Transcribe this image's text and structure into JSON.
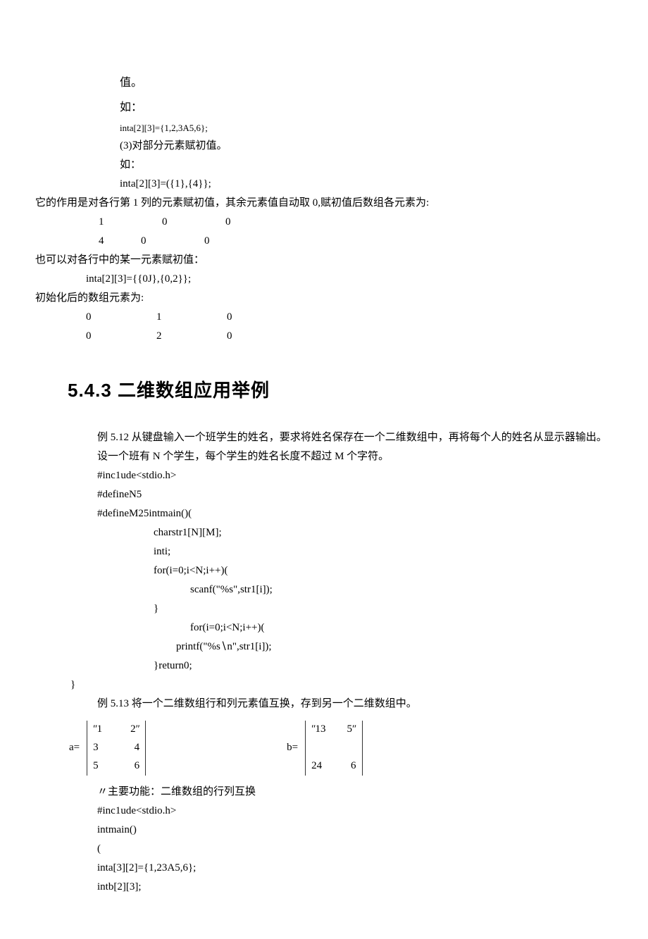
{
  "lines": {
    "l1": "值。",
    "l2": "如：",
    "l3": "inta[2][3]={1,2,3A5,6};",
    "l4": "(3)对部分元素赋初值。",
    "l5": "如：",
    "l6": "inta[2][3]=({1},{4}};",
    "l7": "它的作用是对各行第 1 列的元素赋初值，其余元素值自动取 0,赋初值后数组各元素为:",
    "row1": {
      "a": "1",
      "b": "0",
      "c": "0"
    },
    "row2": {
      "a": "4",
      "b": "0",
      "c": "0"
    },
    "l8": "也可以对各行中的某一元素赋初值：",
    "l9": "inta[2][3]={{0J},{0,2}};",
    "l10": "初始化后的数组元素为:",
    "row3": {
      "a": "0",
      "b": "1",
      "c": "0"
    },
    "row4": {
      "a": "0",
      "b": "2",
      "c": "0"
    }
  },
  "heading": "5.4.3 二维数组应用举例",
  "body": {
    "p1": "例 5.12 从键盘输入一个班学生的姓名，要求将姓名保存在一个二维数组中，再将每个人的姓名从显示器输出。",
    "p2": "设一个班有 N 个学生，每个学生的姓名长度不超过 M 个字符。",
    "c1": "#inc1ude<stdio.h>",
    "c2": "#defineN5",
    "c3": "#defineM25intmain()(",
    "c4": "charstr1[N][M];",
    "c5": "inti;",
    "c6": "for(i=0;i<N;i++)(",
    "c7": "scanf(\"%s\",str1[i]);",
    "c8": "}",
    "c9": "for(i=0;i<N;i++)(",
    "c10": "printf(\"%s∖n\",str1[i]);",
    "c11": "}return0;",
    "c12": "}",
    "p3": "例 5.13 将一个二维数组行和列元素值互换，存到另一个二维数组中。"
  },
  "matrix": {
    "a_label": "a=",
    "b_label": "b=",
    "a": [
      [
        "ʺ1",
        "2ʺ"
      ],
      [
        "3",
        "4"
      ],
      [
        "5",
        "6"
      ]
    ],
    "b": [
      [
        "ʺ13",
        "5ʺ"
      ],
      [
        "",
        ""
      ],
      [
        "24",
        "6"
      ]
    ]
  },
  "body2": {
    "c13": "〃主要功能：二维数组的行列互换",
    "c14": "#inc1ude<stdio.h>",
    "c15": "intmain()",
    "c16": "(",
    "c17": "inta[3][2]={1,23A5,6};",
    "c18": "intb[2][3];"
  }
}
